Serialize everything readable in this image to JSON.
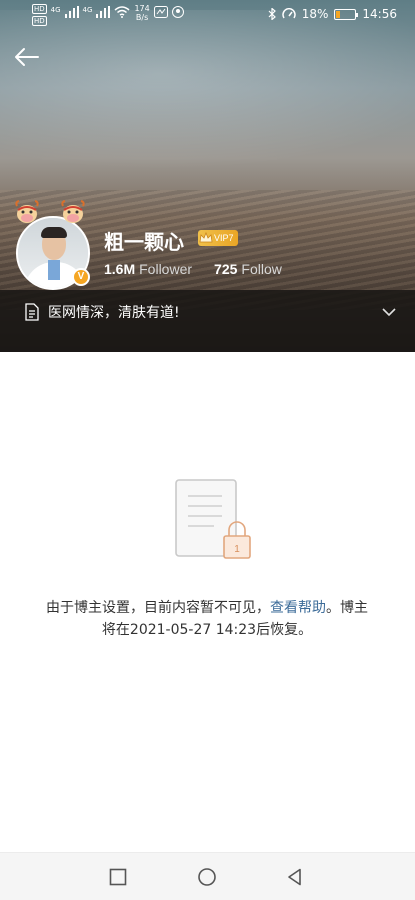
{
  "status_bar": {
    "hd1": "HD",
    "hd2": "HD",
    "net1": "4G",
    "net2": "4G",
    "speed_value": "174",
    "speed_unit": "B/s",
    "battery": "18%",
    "time": "14:56"
  },
  "profile": {
    "name": "粗一颗心",
    "vip_label": "VIP7",
    "followers_count": "1.6M",
    "followers_label": "Follower",
    "following_count": "725",
    "following_label": "Follow",
    "bio": "医网情深，清肤有道!",
    "verified_badge": "V"
  },
  "content_notice": {
    "text_before": "由于博主设置，目前内容暂不可见，",
    "link": "查看帮助",
    "text_after": "。博主将在2021-05-27 14:23后恢复。",
    "lock_number": "1"
  },
  "colors": {
    "link": "#3d6c99",
    "vip_gold": "#e9a526",
    "verified_orange": "#f5a623"
  },
  "icons": {
    "back": "arrow-left-icon",
    "expand": "chevron-down-icon",
    "bio": "document-icon",
    "empty": "locked-document-icon",
    "nav_recent": "square-icon",
    "nav_home": "circle-icon",
    "nav_back": "triangle-back-icon"
  }
}
